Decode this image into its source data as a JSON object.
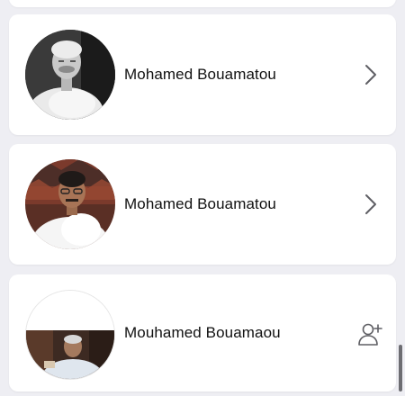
{
  "results": [
    {
      "name": "Mohamed Bouamatou",
      "action": "open",
      "avatar": "grayscale portrait photo",
      "colors": {
        "bg": "#2b2b2b"
      }
    },
    {
      "name": "Mohamed Bouamatou",
      "action": "open",
      "avatar": "color photo, white shirt",
      "colors": {
        "bg": "#7a3b2a"
      }
    },
    {
      "name": "Mouhamed Bouamaou",
      "action": "add-friend",
      "avatar": "partial photo",
      "colors": {
        "bg": "#3d2a22"
      }
    }
  ],
  "icons": {
    "chevron": "chevron-right-icon",
    "add": "add-friend-icon"
  },
  "colors": {
    "background": "#eeeef3",
    "card": "#ffffff",
    "text": "#111111",
    "icon": "#5f5f64"
  }
}
